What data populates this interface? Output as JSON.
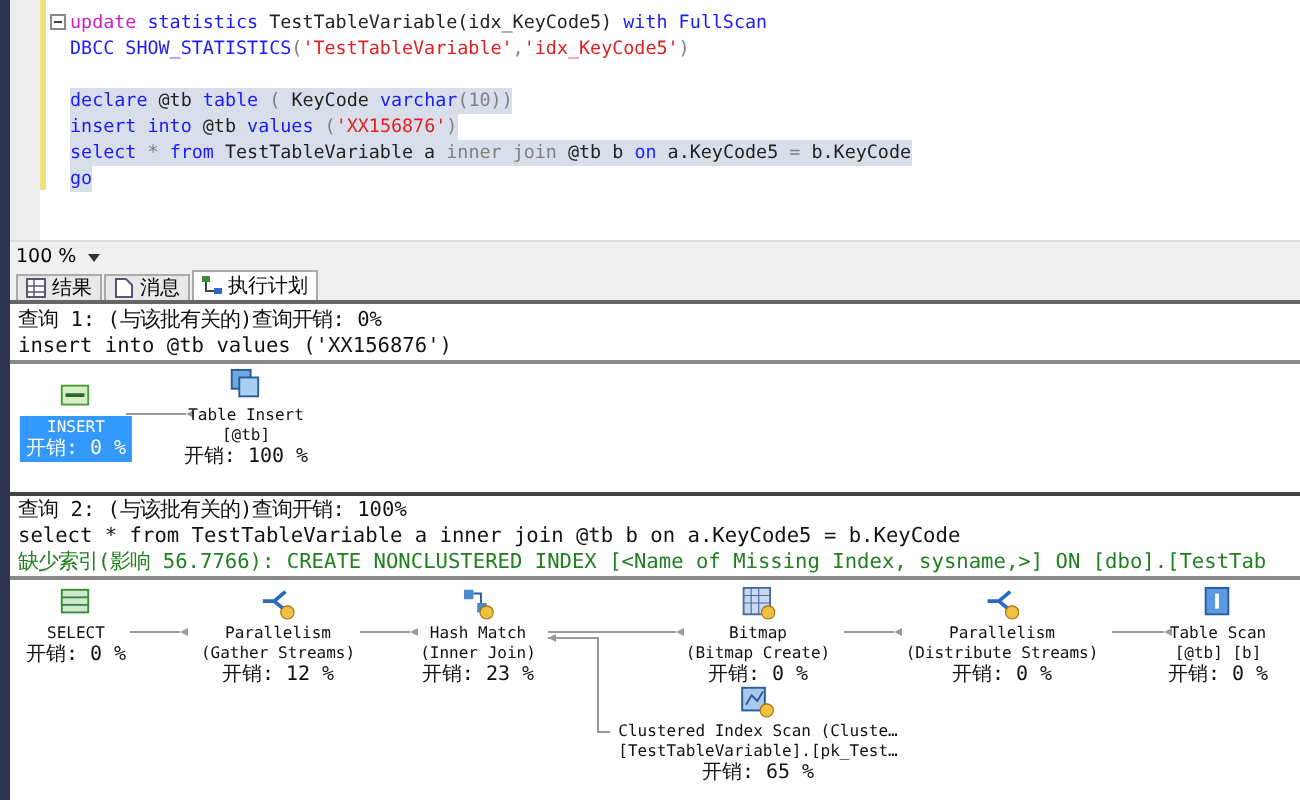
{
  "editor": {
    "blocks": [
      {
        "lines": [
          {
            "selected": false,
            "tokens": [
              {
                "t": "update",
                "kind": "fn"
              },
              {
                "t": " statistics",
                "kind": "kw"
              },
              {
                "t": " TestTableVariable(idx_KeyCode5) ",
                "kind": "id"
              },
              {
                "t": "with",
                "kind": "kw"
              },
              {
                "t": " FullScan",
                "kind": "kw"
              }
            ]
          },
          {
            "selected": false,
            "tokens": [
              {
                "t": "DBCC SHOW_STATISTICS",
                "kind": "kw"
              },
              {
                "t": "(",
                "kind": "op"
              },
              {
                "t": "'TestTableVariable'",
                "kind": "str"
              },
              {
                "t": ",",
                "kind": "op"
              },
              {
                "t": "'idx_KeyCode5'",
                "kind": "str"
              },
              {
                "t": ")",
                "kind": "op"
              }
            ]
          }
        ]
      },
      {
        "lines": [
          {
            "selected": true,
            "tokens": [
              {
                "t": "declare",
                "kind": "kw"
              },
              {
                "t": " @tb ",
                "kind": "id"
              },
              {
                "t": "table",
                "kind": "kw"
              },
              {
                "t": " (",
                "kind": "op"
              },
              {
                "t": " KeyCode ",
                "kind": "id"
              },
              {
                "t": "varchar",
                "kind": "kw"
              },
              {
                "t": "(10))",
                "kind": "op"
              }
            ]
          },
          {
            "selected": true,
            "tokens": [
              {
                "t": "insert into",
                "kind": "kw"
              },
              {
                "t": " @tb ",
                "kind": "id"
              },
              {
                "t": "values",
                "kind": "kw"
              },
              {
                "t": " (",
                "kind": "op"
              },
              {
                "t": "'XX156876'",
                "kind": "str"
              },
              {
                "t": ")",
                "kind": "op"
              }
            ]
          },
          {
            "selected": true,
            "tokens": [
              {
                "t": "select",
                "kind": "kw"
              },
              {
                "t": " * ",
                "kind": "op"
              },
              {
                "t": "from",
                "kind": "kw"
              },
              {
                "t": " TestTableVariable a ",
                "kind": "id"
              },
              {
                "t": "inner join",
                "kind": "op"
              },
              {
                "t": " @tb b ",
                "kind": "id"
              },
              {
                "t": "on",
                "kind": "kw"
              },
              {
                "t": " a.KeyCode5 ",
                "kind": "id"
              },
              {
                "t": "=",
                "kind": "op"
              },
              {
                "t": " b.KeyCode",
                "kind": "id"
              }
            ]
          },
          {
            "selected": true,
            "tokens": [
              {
                "t": "go",
                "kind": "kw"
              }
            ]
          }
        ]
      }
    ]
  },
  "zoom": {
    "value": "100 %"
  },
  "tabs": [
    {
      "label": "结果",
      "kind": "grid",
      "selected": false
    },
    {
      "label": "消息",
      "kind": "doc",
      "selected": false
    },
    {
      "label": "执行计划",
      "kind": "plan",
      "selected": true
    }
  ],
  "plans": [
    {
      "header": "查询 1: (与该批有关的)查询开销: 0%",
      "statement": "insert into @tb values ('XX156876')",
      "nodes": [
        {
          "kind": "insert",
          "lines": [
            "INSERT"
          ],
          "cost": "开销: 0 %",
          "selected": true,
          "parallel": false
        },
        {
          "kind": "table-insert",
          "lines": [
            "Table Insert",
            "[@tb]"
          ],
          "cost": "开销: 100 %",
          "selected": false,
          "parallel": false
        }
      ]
    },
    {
      "header": "查询 2: (与该批有关的)查询开销: 100%",
      "statement": "select * from TestTableVariable a inner join @tb b on a.KeyCode5 = b.KeyCode",
      "missing_index": "缺少索引(影响 56.7766): CREATE NONCLUSTERED INDEX [<Name of Missing Index, sysname,>] ON [dbo].[TestTab",
      "nodes": [
        {
          "kind": "select",
          "lines": [
            "SELECT"
          ],
          "cost": "开销: 0 %",
          "selected": false,
          "parallel": false
        },
        {
          "kind": "parallelism",
          "lines": [
            "Parallelism",
            "(Gather Streams)"
          ],
          "cost": "开销: 12 %",
          "selected": false,
          "parallel": true
        },
        {
          "kind": "hash",
          "lines": [
            "Hash Match",
            "(Inner Join)"
          ],
          "cost": "开销: 23 %",
          "selected": false,
          "parallel": true
        },
        {
          "kind": "bitmap",
          "lines": [
            "Bitmap",
            "(Bitmap Create)"
          ],
          "cost": "开销: 0 %",
          "selected": false,
          "parallel": true
        },
        {
          "kind": "parallelism",
          "lines": [
            "Parallelism",
            "(Distribute Streams)"
          ],
          "cost": "开销: 0 %",
          "selected": false,
          "parallel": true
        },
        {
          "kind": "table-scan",
          "lines": [
            "Table Scan",
            "[@tb] [b]"
          ],
          "cost": "开销: 0 %",
          "selected": false,
          "parallel": false
        },
        {
          "kind": "index-scan",
          "lines": [
            "Clustered Index Scan (Cluste…",
            "[TestTableVariable].[pk_Test…"
          ],
          "cost": "开销: 65 %",
          "selected": false,
          "parallel": true
        }
      ]
    }
  ]
}
